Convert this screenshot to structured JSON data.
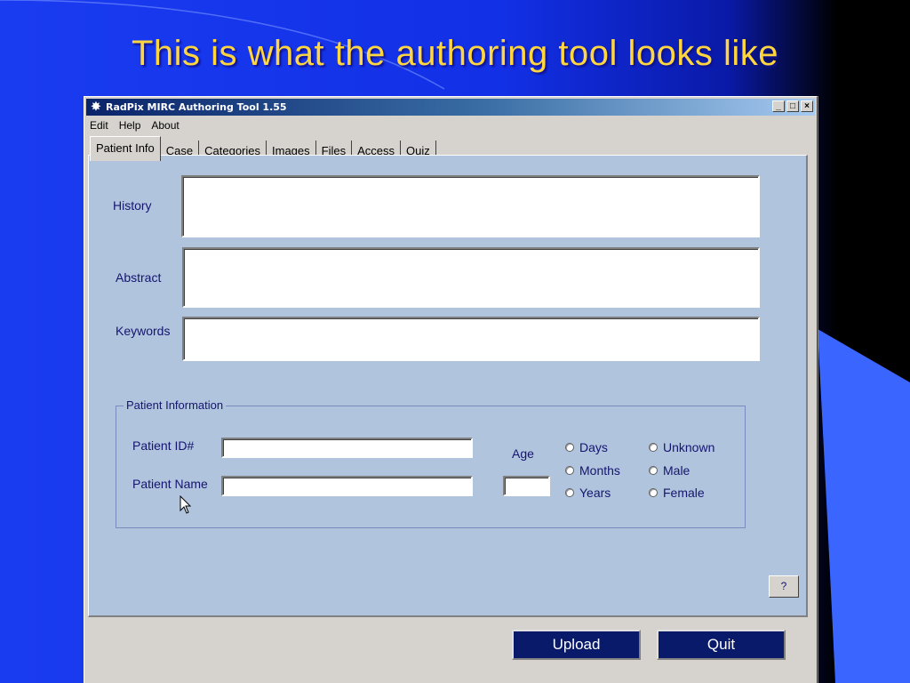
{
  "slide": {
    "title": "This is what the authoring tool looks like"
  },
  "window": {
    "title": "RadPix MIRC Authoring Tool 1.55",
    "icon": "radpix-app-icon",
    "controls": {
      "minimize": "_",
      "maximize": "□",
      "close": "×"
    }
  },
  "menu": {
    "items": [
      "Edit",
      "Help",
      "About"
    ]
  },
  "tabs": [
    "Patient Info",
    "Case",
    "Categories",
    "Images",
    "Files",
    "Access",
    "Quiz"
  ],
  "active_tab": "Patient Info",
  "fields": {
    "history": {
      "label": "History",
      "value": ""
    },
    "abstract": {
      "label": "Abstract",
      "value": ""
    },
    "keywords": {
      "label": "Keywords",
      "value": ""
    }
  },
  "patient_info": {
    "group_title": "Patient Information",
    "patient_id": {
      "label": "Patient ID#",
      "value": ""
    },
    "patient_name": {
      "label": "Patient Name",
      "value": ""
    },
    "age": {
      "label": "Age",
      "value": ""
    },
    "age_units": [
      "Days",
      "Months",
      "Years"
    ],
    "sex": [
      "Unknown",
      "Male",
      "Female"
    ]
  },
  "buttons": {
    "help": "?",
    "upload": "Upload",
    "quit": "Quit"
  },
  "colors": {
    "slide_title": "#ffd640",
    "slide_bg": "#1a3cf0",
    "panel_bg": "#b0c4de",
    "button_bg": "#0a1a6a"
  }
}
